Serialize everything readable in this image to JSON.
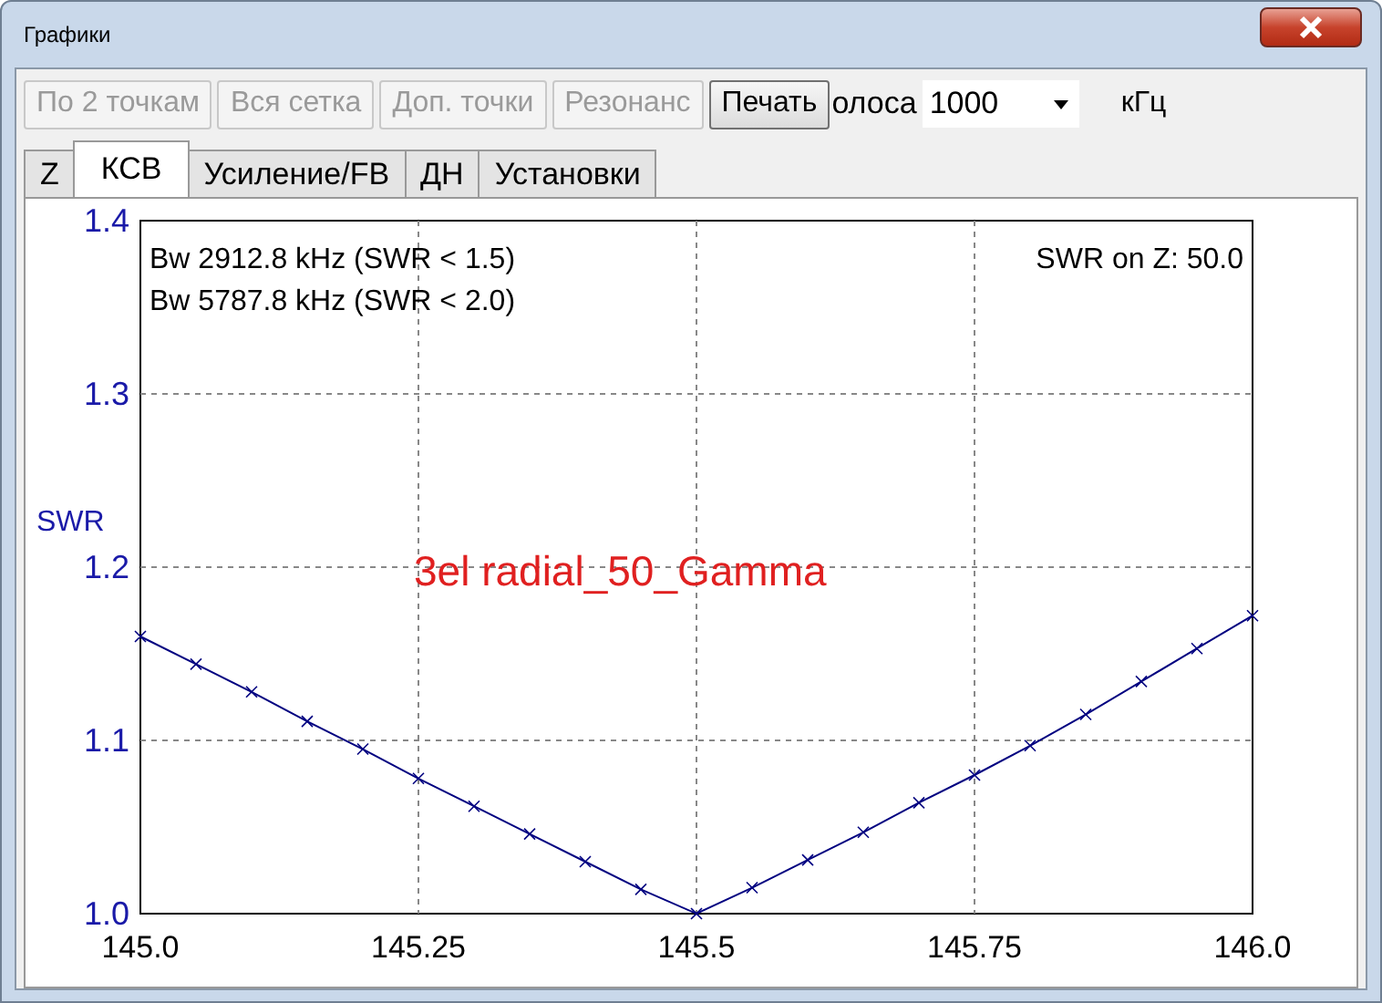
{
  "window": {
    "title": "Графики"
  },
  "toolbar": {
    "buttons": [
      {
        "label": "По 2 точкам",
        "disabled": true
      },
      {
        "label": "Вся сетка",
        "disabled": true
      },
      {
        "label": "Доп. точки",
        "disabled": true
      },
      {
        "label": "Резонанс",
        "disabled": true
      },
      {
        "label": "Печать",
        "disabled": false
      }
    ],
    "band_label": "олоса",
    "band_select": {
      "value": "1000"
    },
    "unit": "кГц"
  },
  "tabs": [
    {
      "label": "Z",
      "selected": false
    },
    {
      "label": "КСВ",
      "selected": true
    },
    {
      "label": "Усиление/FB",
      "selected": false
    },
    {
      "label": "ДН",
      "selected": false
    },
    {
      "label": "Установки",
      "selected": false
    }
  ],
  "chart": {
    "info_lines": [
      "Bw 2912.8 kHz (SWR < 1.5)",
      "Bw 5787.8 kHz (SWR < 2.0)"
    ],
    "impedance_note": "SWR on Z: 50.0",
    "model_label": "3el radial_50_Gamma",
    "chart_data": {
      "type": "line",
      "ylabel": "SWR",
      "x": [
        145.0,
        145.05,
        145.1,
        145.15,
        145.2,
        145.25,
        145.3,
        145.35,
        145.4,
        145.45,
        145.5,
        145.55,
        145.6,
        145.65,
        145.7,
        145.75,
        145.8,
        145.85,
        145.9,
        145.95,
        146.0
      ],
      "grid": true,
      "series": [
        {
          "color": "#000080",
          "marker": "x",
          "values": [
            1.16,
            1.144,
            1.128,
            1.111,
            1.095,
            1.078,
            1.062,
            1.046,
            1.03,
            1.014,
            1.0,
            1.015,
            1.031,
            1.047,
            1.064,
            1.08,
            1.097,
            1.115,
            1.134,
            1.153,
            1.172
          ]
        }
      ],
      "xlim": [
        145.0,
        146.0
      ],
      "ylim": [
        1.0,
        1.4
      ],
      "xticks": [
        {
          "value": 145.0,
          "label": "145.0"
        },
        {
          "value": 145.25,
          "label": "145.25"
        },
        {
          "value": 145.5,
          "label": "145.5"
        },
        {
          "value": 145.75,
          "label": "145.75"
        },
        {
          "value": 146.0,
          "label": "146.0"
        }
      ],
      "yticks": [
        {
          "value": 1.0,
          "label": "1.0"
        },
        {
          "value": 1.1,
          "label": "1.1"
        },
        {
          "value": 1.2,
          "label": "1.2"
        },
        {
          "value": 1.3,
          "label": "1.3"
        },
        {
          "value": 1.4,
          "label": "1.4"
        }
      ]
    }
  }
}
